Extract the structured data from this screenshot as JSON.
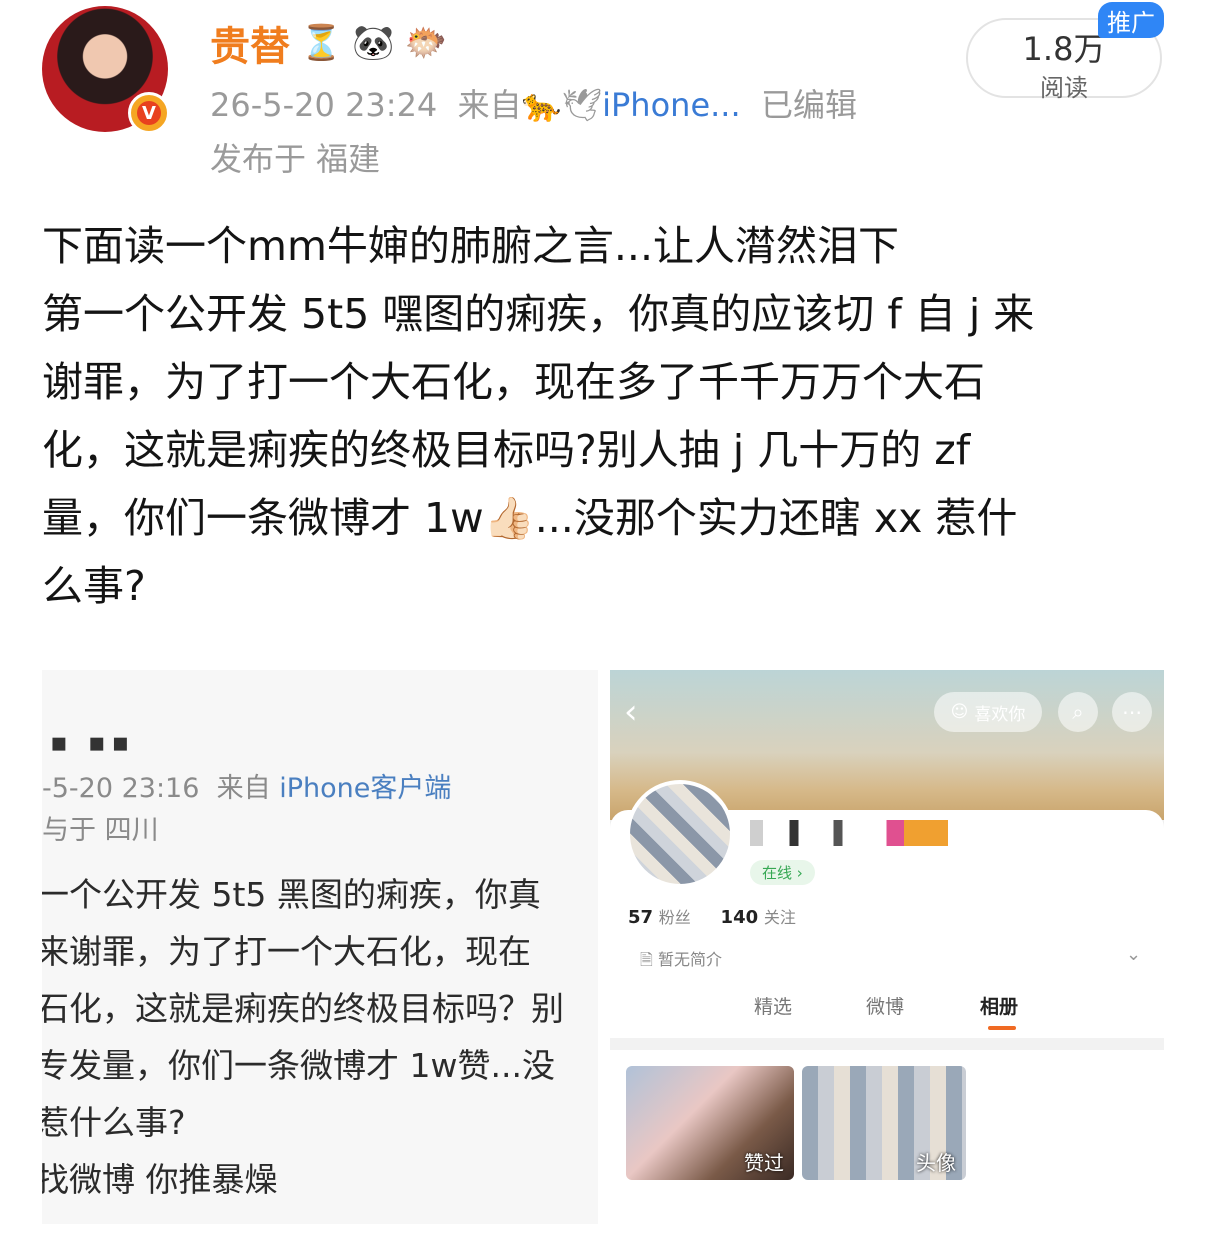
{
  "header": {
    "username": "贵替",
    "badge_icons": [
      "hourglass-icon",
      "panda-icon",
      "pufferfish-icon"
    ],
    "time": "26-5-20 23:24",
    "from_label": "来自",
    "source_icons": [
      "leopard-icon",
      "dove-icon"
    ],
    "source_app": "iPhone...",
    "edited": "已编辑",
    "location": "发布于 福建",
    "read_count": "1.8万",
    "read_label": "阅读",
    "promo_label": "推广",
    "verified_mark": "V"
  },
  "post": {
    "lines": [
      "下面读一个mm牛婶的肺腑之言...让人潸然泪下",
      "第一个公开发 5t5 嘿图的痢疾，你真的应该切 f 自 j 来",
      "谢罪，为了打一个大石化，现在多了千千万万个大石",
      "化，这就是痢疾的终极目标吗?别人抽 j 几十万的 zf",
      "量，你们一条微博才 1w",
      "么事?"
    ],
    "thumbs_emoji": "👍🏻",
    "line5_tail": "...没那个实力还瞎 xx 惹什"
  },
  "image_left": {
    "dots": "▪ ▪▪",
    "time": "-5-20 23:16",
    "from": "来自",
    "source": "iPhone客户端",
    "location": "与于 四川",
    "lines": [
      "一个公开发 5t5 黑图的痢疾，你真",
      "来谢罪，为了打一个大石化，现在",
      "石化，这就是痢疾的终极目标吗？别",
      "专发量，你们一条微博才 1w赞...没",
      "惹什么事?",
      "找微博  你推暴燥"
    ]
  },
  "image_right": {
    "back": "‹",
    "like_label": "喜欢你",
    "online_label": "在线 ›",
    "fans_count": "57",
    "fans_label": "粉丝",
    "follow_count": "140",
    "follow_label": "关注",
    "bio": "暂无简介",
    "tabs": [
      "精选",
      "微博",
      "相册"
    ],
    "active_tab": "相册",
    "photo1_label": "赞过",
    "photo2_label": "头像"
  },
  "colors": {
    "username": "#f07d1e",
    "source_link": "#3a7bd5",
    "promo_bg": "#2f86f6",
    "tab_underline": "#f06a23"
  }
}
